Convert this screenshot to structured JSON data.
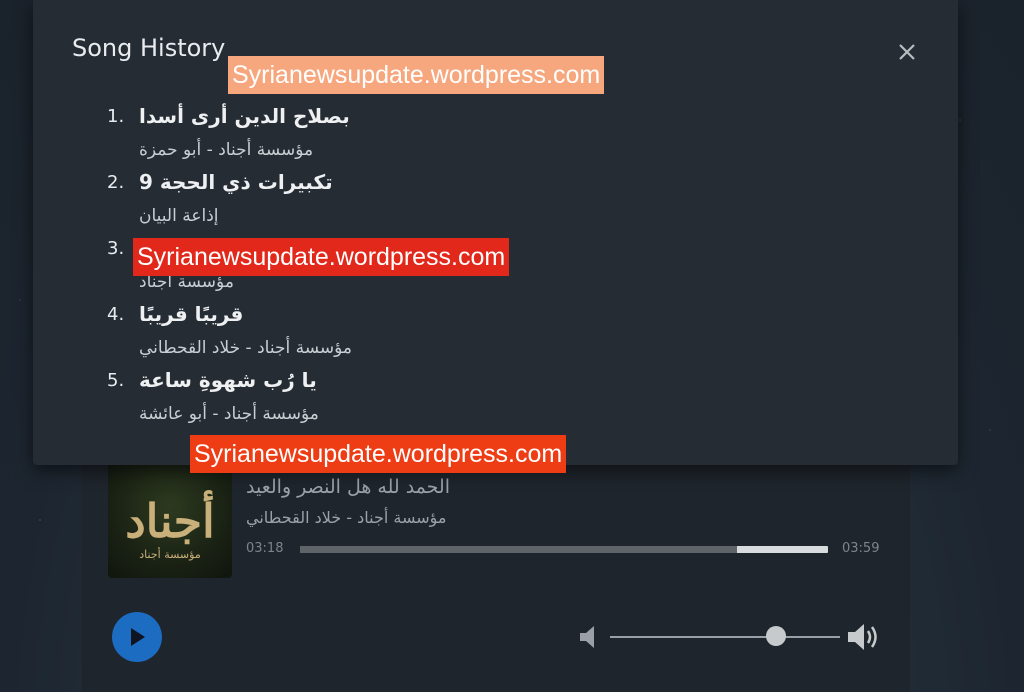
{
  "dialog": {
    "title": "Song History",
    "close_icon": "close-icon",
    "items": [
      {
        "num": "1.",
        "title": "بصلاح الدين أرى أسدا",
        "artist": "مؤسسة أجناد - أبو حمزة"
      },
      {
        "num": "2.",
        "title": "تكبيرات ذي الحجة 9",
        "artist": "إذاعة البيان"
      },
      {
        "num": "3.",
        "title": "",
        "artist": "مؤسسة أجناد"
      },
      {
        "num": "4.",
        "title": "قريبًا قريبًا",
        "artist": "مؤسسة أجناد - خلاد القحطاني"
      },
      {
        "num": "5.",
        "title": "يا رُب شهوةِ ساعة",
        "artist": "مؤسسة أجناد - أبو عائشة"
      }
    ]
  },
  "player": {
    "cover_logo_text": "أجناد",
    "cover_sub_text": "مؤسسة أجناد",
    "track_title": "الحمد لله هل النصر والعيد",
    "track_artist": "مؤسسة أجناد - خلاد القحطاني",
    "time_elapsed": "03:18",
    "time_total": "03:59",
    "progress_fraction": 0.828,
    "volume_fraction": 0.72,
    "play_icon": "play-icon",
    "volume_low_icon": "volume-low-icon",
    "volume_high_icon": "volume-high-icon",
    "accent_color": "#1c6cc2"
  },
  "watermarks": [
    "Syrianewsupdate.wordpress.com",
    "Syrianewsupdate.wordpress.com",
    "Syrianewsupdate.wordpress.com"
  ]
}
